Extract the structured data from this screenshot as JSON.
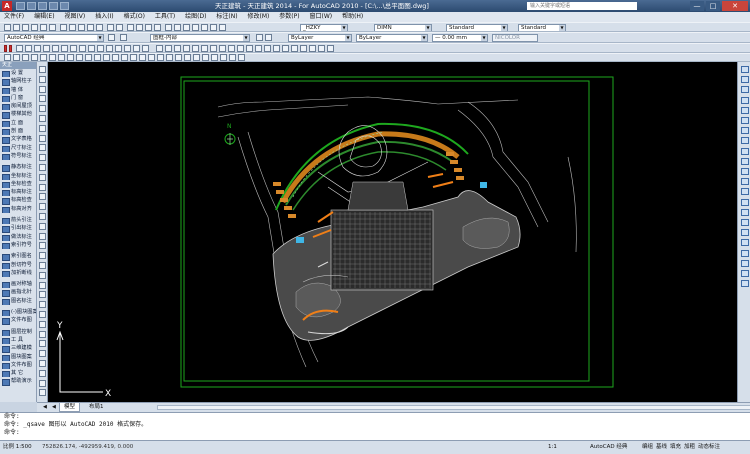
{
  "titlebar": {
    "title": "天正建筑 - 天正建筑 2014 - For AutoCAD 2010 - [C:\\...\\总平面图.dwg]",
    "search_placeholder": "输入关键字或短语",
    "min": "—",
    "max": "□",
    "close": "✕"
  },
  "menu": [
    "文件(F)",
    "编辑(E)",
    "视图(V)",
    "插入(I)",
    "格式(O)",
    "工具(T)",
    "绘图(D)",
    "标注(N)",
    "修改(M)",
    "参数(P)",
    "窗口(W)",
    "帮助(H)"
  ],
  "toolbar": {
    "textstyle": "_HZKY",
    "dimstyle": "DIMN",
    "tablestyle": "Standard",
    "mlstyle": "Standard",
    "workspace": "AutoCAD 经典",
    "layer": "图框-内部",
    "color": "ByLayer",
    "linetype": "ByLayer",
    "lineweight": "— 0.00 mm",
    "plotstyle": "NICOLOR"
  },
  "tarch_panel": {
    "caption": "天正",
    "items": [
      "设  置",
      "轴网柱子",
      "墙  体",
      "门  窗",
      "房间屋顶",
      "楼梯其他",
      "立  面",
      "剖  面",
      "文字表格",
      "尺寸标注",
      "符号标注",
      "",
      "静态标注",
      "坐标标注",
      "坐标检查",
      "标高标注",
      "标高检查",
      "标高对齐",
      "",
      "箭头引注",
      "引出标注",
      "做法标注",
      "索引符号",
      "",
      "索引图名",
      "剖切符号",
      "加折断线",
      "",
      "画对称轴",
      "画指北针",
      "图名标注",
      "",
      "(-)图块图案",
      "文件布图",
      "",
      "图层控制",
      "工    具",
      "三维建模",
      "图块图案",
      "文件布图",
      "其    它",
      "帮助演示"
    ]
  },
  "drawing": {
    "north_label": "N",
    "ucs_y": "Y",
    "ucs_x": "X"
  },
  "tabs": {
    "model": "模型",
    "layout1": "布局1"
  },
  "command": {
    "line1": "命令:",
    "line2": "命令: _qsave 图形以 AutoCAD 2010 格式保存。",
    "line3": "命令:"
  },
  "status": {
    "scale": "比例 1:500",
    "coords": "752826.174, -492959.419, 0.000",
    "annoscale": "1:1",
    "workspace": "AutoCAD 经典",
    "items": [
      "编组",
      "基线",
      "填充",
      "加粗",
      "动态标注"
    ]
  },
  "colors": {
    "bg": "#000000",
    "frame": "#1ea81e",
    "site": "#444444",
    "road": "#cccccc"
  }
}
